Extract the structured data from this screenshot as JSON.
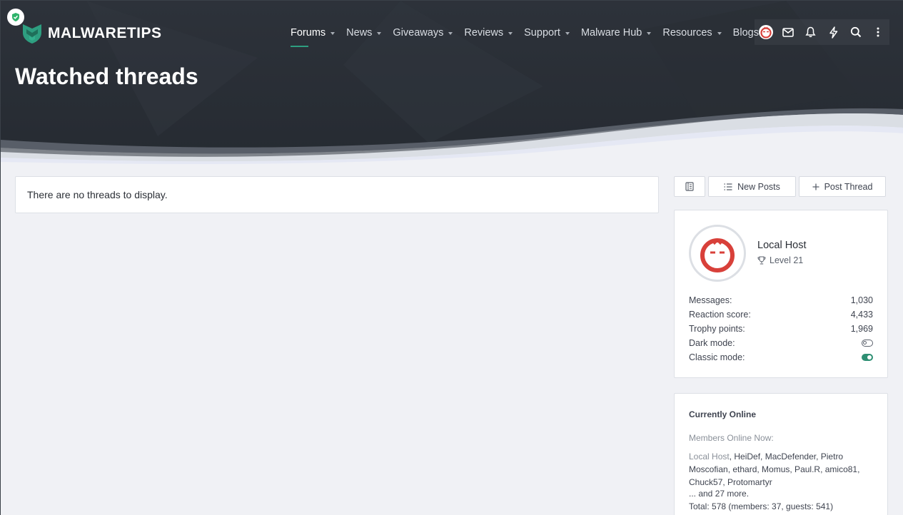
{
  "brand": {
    "name": "MALWARETIPS",
    "accent": "#2e9e80",
    "header_bg": "#2b3038"
  },
  "nav": {
    "items": [
      {
        "label": "Forums",
        "active": true
      },
      {
        "label": "News"
      },
      {
        "label": "Giveaways"
      },
      {
        "label": "Reviews"
      },
      {
        "label": "Support"
      },
      {
        "label": "Malware Hub"
      },
      {
        "label": "Resources"
      },
      {
        "label": "Blogs"
      }
    ]
  },
  "user_tools": [
    "avatar",
    "mail-icon",
    "bell-icon",
    "lightning-icon",
    "search-icon",
    "more-vertical-icon"
  ],
  "page": {
    "title": "Watched threads",
    "empty_message": "There are no threads to display."
  },
  "actions": {
    "new_posts": "New Posts",
    "post_thread": "Post Thread"
  },
  "profile": {
    "name": "Local Host",
    "level": "Level 21",
    "stats": [
      {
        "label": "Messages:",
        "value": "1,030"
      },
      {
        "label": "Reaction score:",
        "value": "4,433"
      },
      {
        "label": "Trophy points:",
        "value": "1,969"
      }
    ],
    "toggles": [
      {
        "label": "Dark mode:",
        "on": false
      },
      {
        "label": "Classic mode:",
        "on": true
      }
    ]
  },
  "online": {
    "title": "Currently Online",
    "subtitle": "Members Online Now:",
    "current_user": "Local Host",
    "members": ", HeiDef, MacDefender, Pietro Moscofian, ethard, Momus, Paul.R, amico81, Chuck57, Protomartyr",
    "more": "... and 27 more.",
    "total": "Total: 578 (members: 37, guests: 541)"
  }
}
